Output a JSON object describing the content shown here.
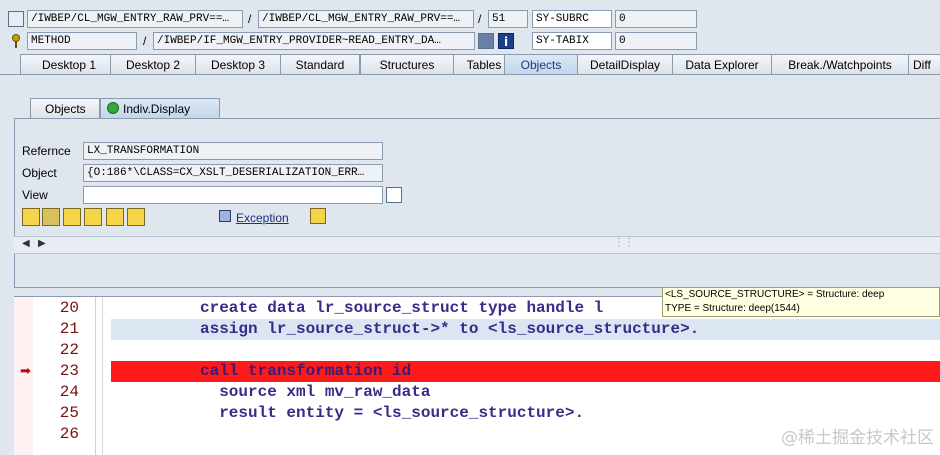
{
  "top_bar": {
    "row1": {
      "program": "/IWBEP/CL_MGW_ENTRY_RAW_PRV==…",
      "include": "/IWBEP/CL_MGW_ENTRY_RAW_PRV==…",
      "line": "51",
      "var_name": "SY-SUBRC",
      "var_value": "0"
    },
    "row2": {
      "event_type": "METHOD",
      "event_name": "/IWBEP/IF_MGW_ENTRY_PROVIDER~READ_ENTRY_DA…",
      "var_name": "SY-TABIX",
      "var_value": "0"
    }
  },
  "tabs": [
    "Desktop 1",
    "Desktop 2",
    "Desktop 3",
    "Standard",
    "Structures",
    "Tables",
    "Objects",
    "DetailDisplay",
    "Data Explorer",
    "Break./Watchpoints",
    "Diff"
  ],
  "active_tab": "Objects",
  "subtabs": {
    "objects": "Objects",
    "indiv_display": "Indiv.Display"
  },
  "form": {
    "reference_label": "Refernce",
    "reference_value": "LX_TRANSFORMATION",
    "object_label": "Object",
    "object_value": "{O:186*\\CLASS=CX_XSLT_DESERIALIZATION_ERR…",
    "view_label": "View",
    "view_value": ""
  },
  "toolbar": {
    "exception_label": "Exception"
  },
  "editor": {
    "lines": [
      {
        "num": "20",
        "code": "create data lr_source_struct type handle l"
      },
      {
        "num": "21",
        "code": "assign lr_source_struct->* to <ls_source_structure>."
      },
      {
        "num": "22",
        "code": ""
      },
      {
        "num": "23",
        "code": "call transformation id"
      },
      {
        "num": "24",
        "code": "  source xml mv_raw_data"
      },
      {
        "num": "25",
        "code": "  result entity = <ls_source_structure>."
      },
      {
        "num": "26",
        "code": ""
      }
    ],
    "highlight_line": "23"
  },
  "tooltip": {
    "line1": "<LS_SOURCE_STRUCTURE> = Structure: deep",
    "line2": "TYPE = Structure: deep(1544)"
  },
  "watermark": "@稀土掘金技术社区",
  "colors": {
    "highlight": "#ff1a1a",
    "current_line": "#dbe6f2",
    "accent": "#1b3b7a"
  }
}
